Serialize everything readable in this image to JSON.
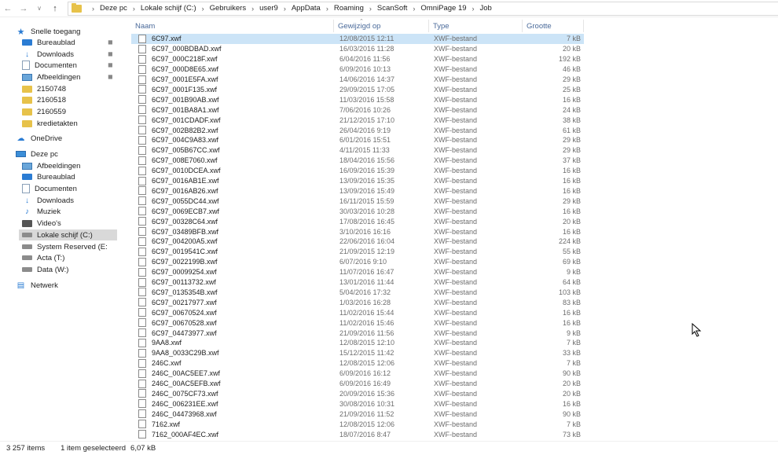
{
  "nav": {
    "back_icon": "back-arrow-icon",
    "forward_icon": "forward-arrow-icon",
    "recent_icon": "chevron-down-icon",
    "up_icon": "up-arrow-icon"
  },
  "breadcrumb": [
    "Deze pc",
    "Lokale schijf (C:)",
    "Gebruikers",
    "user9",
    "AppData",
    "Roaming",
    "ScanSoft",
    "OmniPage 19",
    "Job"
  ],
  "sidebar": {
    "items": [
      {
        "label": "Snelle toegang",
        "icon": "star-icon"
      },
      {
        "label": "Bureaublad",
        "icon": "desktop-icon"
      },
      {
        "label": "Downloads",
        "icon": "download-icon"
      },
      {
        "label": "Documenten",
        "icon": "documents-icon"
      },
      {
        "label": "Afbeeldingen",
        "icon": "pictures-icon"
      },
      {
        "label": "2150748",
        "icon": "folder-icon"
      },
      {
        "label": "2160518",
        "icon": "folder-icon"
      },
      {
        "label": "2160559",
        "icon": "folder-icon"
      },
      {
        "label": "kredietakten",
        "icon": "folder-icon"
      },
      {
        "label": "OneDrive",
        "icon": "cloud-icon"
      },
      {
        "label": "Deze pc",
        "icon": "computer-icon"
      },
      {
        "label": "Afbeeldingen",
        "icon": "pictures-icon"
      },
      {
        "label": "Bureaublad",
        "icon": "desktop-icon"
      },
      {
        "label": "Documenten",
        "icon": "documents-icon"
      },
      {
        "label": "Downloads",
        "icon": "download-icon"
      },
      {
        "label": "Muziek",
        "icon": "music-icon"
      },
      {
        "label": "Video's",
        "icon": "video-icon"
      },
      {
        "label": "Lokale schijf (C:)",
        "icon": "drive-icon"
      },
      {
        "label": "System Reserved (E:",
        "icon": "drive-icon"
      },
      {
        "label": "Acta (T:)",
        "icon": "drive-icon"
      },
      {
        "label": "Data (W:)",
        "icon": "drive-icon"
      },
      {
        "label": "Netwerk",
        "icon": "network-icon"
      }
    ]
  },
  "columns": {
    "name": "Naam",
    "date": "Gewijzigd op",
    "type": "Type",
    "size": "Grootte"
  },
  "files": [
    {
      "name": "6C97.xwf",
      "date": "12/08/2015 12:11",
      "type": "XWF-bestand",
      "size": "7 kB"
    },
    {
      "name": "6C97_000BDBAD.xwf",
      "date": "16/03/2016 11:28",
      "type": "XWF-bestand",
      "size": "20 kB"
    },
    {
      "name": "6C97_000C218F.xwf",
      "date": "6/04/2016 11:56",
      "type": "XWF-bestand",
      "size": "192 kB"
    },
    {
      "name": "6C97_000D8E65.xwf",
      "date": "6/09/2016 10:13",
      "type": "XWF-bestand",
      "size": "46 kB"
    },
    {
      "name": "6C97_0001E5FA.xwf",
      "date": "14/06/2016 14:37",
      "type": "XWF-bestand",
      "size": "29 kB"
    },
    {
      "name": "6C97_0001F135.xwf",
      "date": "29/09/2015 17:05",
      "type": "XWF-bestand",
      "size": "25 kB"
    },
    {
      "name": "6C97_001B90AB.xwf",
      "date": "11/03/2016 15:58",
      "type": "XWF-bestand",
      "size": "16 kB"
    },
    {
      "name": "6C97_001BA8A1.xwf",
      "date": "7/06/2016 10:26",
      "type": "XWF-bestand",
      "size": "24 kB"
    },
    {
      "name": "6C97_001CDADF.xwf",
      "date": "21/12/2015 17:10",
      "type": "XWF-bestand",
      "size": "38 kB"
    },
    {
      "name": "6C97_002B82B2.xwf",
      "date": "26/04/2016 9:19",
      "type": "XWF-bestand",
      "size": "61 kB"
    },
    {
      "name": "6C97_004C9A83.xwf",
      "date": "6/01/2016 15:51",
      "type": "XWF-bestand",
      "size": "29 kB"
    },
    {
      "name": "6C97_005B67CC.xwf",
      "date": "4/11/2015 11:33",
      "type": "XWF-bestand",
      "size": "29 kB"
    },
    {
      "name": "6C97_008E7060.xwf",
      "date": "18/04/2016 15:56",
      "type": "XWF-bestand",
      "size": "37 kB"
    },
    {
      "name": "6C97_0010DCEA.xwf",
      "date": "16/09/2016 15:39",
      "type": "XWF-bestand",
      "size": "16 kB"
    },
    {
      "name": "6C97_0016AB1E.xwf",
      "date": "13/09/2016 15:35",
      "type": "XWF-bestand",
      "size": "16 kB"
    },
    {
      "name": "6C97_0016AB26.xwf",
      "date": "13/09/2016 15:49",
      "type": "XWF-bestand",
      "size": "16 kB"
    },
    {
      "name": "6C97_0055DC44.xwf",
      "date": "16/11/2015 15:59",
      "type": "XWF-bestand",
      "size": "29 kB"
    },
    {
      "name": "6C97_0069ECB7.xwf",
      "date": "30/03/2016 10:28",
      "type": "XWF-bestand",
      "size": "16 kB"
    },
    {
      "name": "6C97_00328C64.xwf",
      "date": "17/08/2016 16:45",
      "type": "XWF-bestand",
      "size": "20 kB"
    },
    {
      "name": "6C97_03489BFB.xwf",
      "date": "3/10/2016 16:16",
      "type": "XWF-bestand",
      "size": "16 kB"
    },
    {
      "name": "6C97_004200A5.xwf",
      "date": "22/06/2016 16:04",
      "type": "XWF-bestand",
      "size": "224 kB"
    },
    {
      "name": "6C97_0019541C.xwf",
      "date": "21/09/2015 12:19",
      "type": "XWF-bestand",
      "size": "55 kB"
    },
    {
      "name": "6C97_0022199B.xwf",
      "date": "6/07/2016 9:10",
      "type": "XWF-bestand",
      "size": "69 kB"
    },
    {
      "name": "6C97_00099254.xwf",
      "date": "11/07/2016 16:47",
      "type": "XWF-bestand",
      "size": "9 kB"
    },
    {
      "name": "6C97_00113732.xwf",
      "date": "13/01/2016 11:44",
      "type": "XWF-bestand",
      "size": "64 kB"
    },
    {
      "name": "6C97_0135354B.xwf",
      "date": "5/04/2016 17:32",
      "type": "XWF-bestand",
      "size": "103 kB"
    },
    {
      "name": "6C97_00217977.xwf",
      "date": "1/03/2016 16:28",
      "type": "XWF-bestand",
      "size": "83 kB"
    },
    {
      "name": "6C97_00670524.xwf",
      "date": "11/02/2016 15:44",
      "type": "XWF-bestand",
      "size": "16 kB"
    },
    {
      "name": "6C97_00670528.xwf",
      "date": "11/02/2016 15:46",
      "type": "XWF-bestand",
      "size": "16 kB"
    },
    {
      "name": "6C97_04473977.xwf",
      "date": "21/09/2016 11:56",
      "type": "XWF-bestand",
      "size": "9 kB"
    },
    {
      "name": "9AA8.xwf",
      "date": "12/08/2015 12:10",
      "type": "XWF-bestand",
      "size": "7 kB"
    },
    {
      "name": "9AA8_0033C29B.xwf",
      "date": "15/12/2015 11:42",
      "type": "XWF-bestand",
      "size": "33 kB"
    },
    {
      "name": "246C.xwf",
      "date": "12/08/2015 12:06",
      "type": "XWF-bestand",
      "size": "7 kB"
    },
    {
      "name": "246C_00AC5EE7.xwf",
      "date": "6/09/2016 16:12",
      "type": "XWF-bestand",
      "size": "90 kB"
    },
    {
      "name": "246C_00AC5EFB.xwf",
      "date": "6/09/2016 16:49",
      "type": "XWF-bestand",
      "size": "20 kB"
    },
    {
      "name": "246C_0075CF73.xwf",
      "date": "20/09/2016 15:36",
      "type": "XWF-bestand",
      "size": "20 kB"
    },
    {
      "name": "246C_006231EE.xwf",
      "date": "30/08/2016 10:31",
      "type": "XWF-bestand",
      "size": "16 kB"
    },
    {
      "name": "246C_04473968.xwf",
      "date": "21/09/2016 11:52",
      "type": "XWF-bestand",
      "size": "90 kB"
    },
    {
      "name": "7162.xwf",
      "date": "12/08/2015 12:06",
      "type": "XWF-bestand",
      "size": "7 kB"
    },
    {
      "name": "7162_000AF4EC.xwf",
      "date": "18/07/2016 8:47",
      "type": "XWF-bestand",
      "size": "73 kB"
    }
  ],
  "status": {
    "items_count": "3 257 items",
    "selected": "1 item geselecteerd",
    "selected_size": "6,07 kB"
  }
}
